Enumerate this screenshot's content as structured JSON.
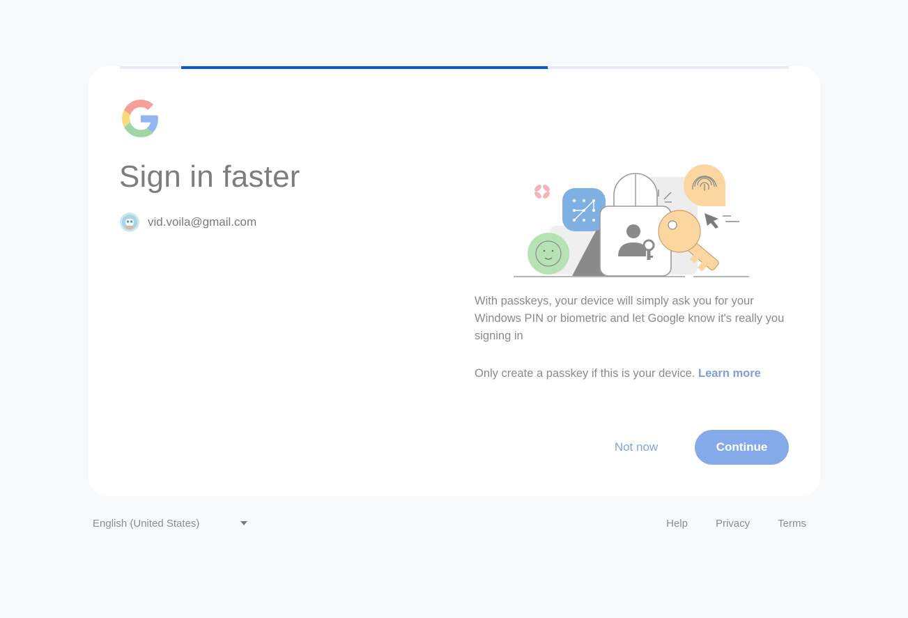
{
  "progress": {
    "value": 0.64
  },
  "card": {
    "title": "Sign in faster",
    "account": {
      "email": "vid.voila@gmail.com"
    },
    "description": "With passkeys, your device will simply ask you for your Windows PIN or biometric and let Google know it's really you signing in",
    "note": "Only create a passkey if this is your device.",
    "learn_more": "Learn more",
    "buttons": {
      "not_now": "Not now",
      "continue": "Continue"
    }
  },
  "footer": {
    "language": "English (United States)",
    "links": {
      "help": "Help",
      "privacy": "Privacy",
      "terms": "Terms"
    }
  },
  "colors": {
    "page_background": "#f8f9fb",
    "progress": "#0b57d0",
    "primary_button": "#85aaea",
    "link": "#7d9fdc"
  },
  "icons": {
    "logo": "google-g-icon",
    "avatar": "avatar-icon",
    "caret": "chevron-down-icon"
  }
}
